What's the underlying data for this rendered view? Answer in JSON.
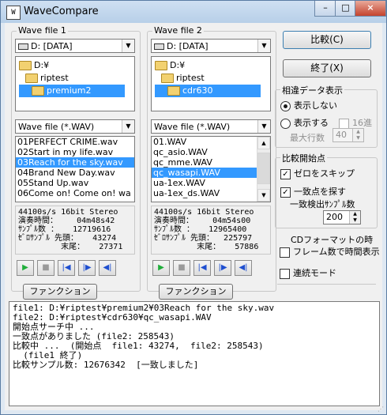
{
  "window": {
    "title": "WaveCompare",
    "icon_text": "W"
  },
  "window_controls": {
    "minimize": "–",
    "maximize": "□",
    "close": "×"
  },
  "file1": {
    "group_label": "Wave file 1",
    "drive": "D: [DATA]",
    "tree": [
      {
        "label": "D:¥"
      },
      {
        "label": "riptest"
      },
      {
        "label": "premium2",
        "selected": true
      }
    ],
    "filter": "Wave file (*.WAV)",
    "files": [
      "01PERFECT CRIME.wav",
      "02Start in my life.wav",
      "03Reach for the sky.wav",
      "04Brand New Day.wav",
      "05Stand Up.wav",
      "06Come on! Come on! wa"
    ],
    "selected_index": 2,
    "info": [
      "44100s/s 16bit Stereo",
      "演奏時間：    04m48s42",
      "ｻﾝﾌﾟﾙ数 ：   12719616",
      "ｾﾞﾛｻﾝﾌﾟﾙ 先頭：   43274",
      "         末尾：   27371"
    ],
    "function_button": "ファンクション(1)..."
  },
  "file2": {
    "group_label": "Wave file 2",
    "drive": "D: [DATA]",
    "tree": [
      {
        "label": "D:¥"
      },
      {
        "label": "riptest"
      },
      {
        "label": "cdr630",
        "selected": true
      }
    ],
    "filter": "Wave file (*.WAV)",
    "files": [
      "01.WAV",
      "qc_asio.WAV",
      "qc_mme.WAV",
      "qc_wasapi.WAV",
      "ua-1ex.WAV",
      "ua-1ex_ds.WAV"
    ],
    "selected_index": 3,
    "info": [
      "44100s/s 16bit Stereo",
      "演奏時間：    04m54s00",
      "ｻﾝﾌﾟﾙ数 ：   12965400",
      "ｾﾞﾛｻﾝﾌﾟﾙ 先頭：  225797",
      "         末尾：   57886"
    ],
    "function_button": "ファンクション(2)..."
  },
  "actions": {
    "compare": "比較(C)",
    "exit": "終了(X)"
  },
  "diff_display": {
    "group_label": "相違データ表示",
    "no_display": "表示しない",
    "display": "表示する",
    "hex": "16進",
    "max_rows_label": "最大行数",
    "max_rows": "40"
  },
  "compare_start": {
    "group_label": "比較開始点",
    "skip_zero": "ゼロをスキップ",
    "find_match": "一致点を探す",
    "match_samples_label": "一致検出ｻﾝﾌﾟﾙ数",
    "match_samples": "200"
  },
  "cd_format": {
    "label": "CDフォーマットの時",
    "frame_time": "フレーム数で時間表示"
  },
  "continuous_mode": "連続モード",
  "log": [
    "file1: D:¥riptest¥premium2¥03Reach for the sky.wav",
    "file2: D:¥riptest¥cdr630¥qc_wasapi.WAV",
    "開始点サーチ中 ...",
    "一致点がありました (file2: 258543)",
    "比較中 ...  (開始点  file1: 43274,  file2: 258543)",
    "  (file1 終了)",
    "比較サンプル数: 12676342  [一致しました]"
  ]
}
